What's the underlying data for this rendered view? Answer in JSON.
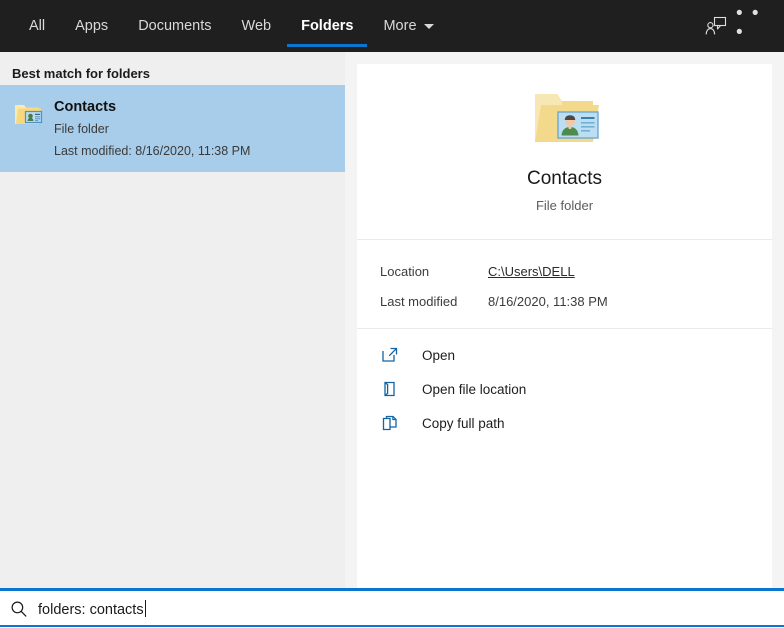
{
  "topbar": {
    "tabs": [
      {
        "label": "All",
        "active": false
      },
      {
        "label": "Apps",
        "active": false
      },
      {
        "label": "Documents",
        "active": false
      },
      {
        "label": "Web",
        "active": false
      },
      {
        "label": "Folders",
        "active": true
      },
      {
        "label": "More",
        "active": false
      }
    ],
    "feedback_icon": "feedback-person-icon",
    "more_options": "• • •",
    "accent_color": "#0b76cf",
    "background_color": "#1f1f1f"
  },
  "results": {
    "group_header": "Best match for folders",
    "selected_color": "#a8cdea",
    "items": [
      {
        "title": "Contacts",
        "subtitle": "File folder",
        "meta": "Last modified: 8/16/2020, 11:38 PM",
        "icon": "contacts-folder-icon",
        "selected": true
      }
    ]
  },
  "preview": {
    "icon": "contacts-folder-icon",
    "title": "Contacts",
    "subtitle": "File folder",
    "details": [
      {
        "label": "Location",
        "value": "C:\\Users\\DELL",
        "is_link": true
      },
      {
        "label": "Last modified",
        "value": "8/16/2020, 11:38 PM",
        "is_link": false
      }
    ],
    "actions": [
      {
        "label": "Open",
        "icon": "open-external-icon"
      },
      {
        "label": "Open file location",
        "icon": "folder-location-icon"
      },
      {
        "label": "Copy full path",
        "icon": "copy-page-icon"
      }
    ]
  },
  "search": {
    "icon": "search-icon",
    "value": "folders: contacts",
    "placeholder": "Type here to search",
    "border_color": "#0b76cf"
  }
}
